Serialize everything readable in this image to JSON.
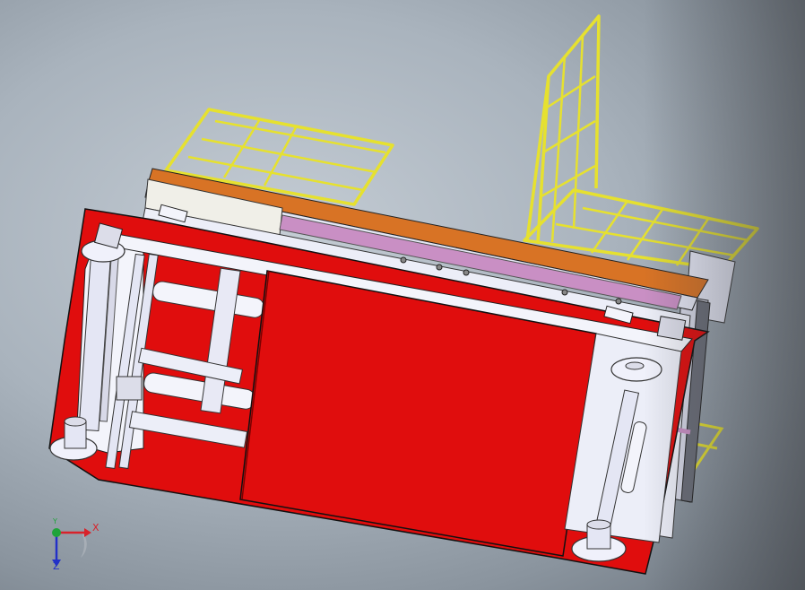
{
  "viewport": {
    "background_top": "#b8c1ca",
    "background_bottom": "#6a727b"
  },
  "model": {
    "body_color": "#e00d0d",
    "frame_color": "#e6e12f",
    "trim_color": "#d87325",
    "accent_color": "#c98fc4",
    "part_color": "#e4e6f4"
  },
  "triad": {
    "x_label": "X",
    "y_label": "Y",
    "z_label": "Z",
    "x_color": "#d8222a",
    "y_color": "#1fa33a",
    "z_color": "#2230c8"
  }
}
